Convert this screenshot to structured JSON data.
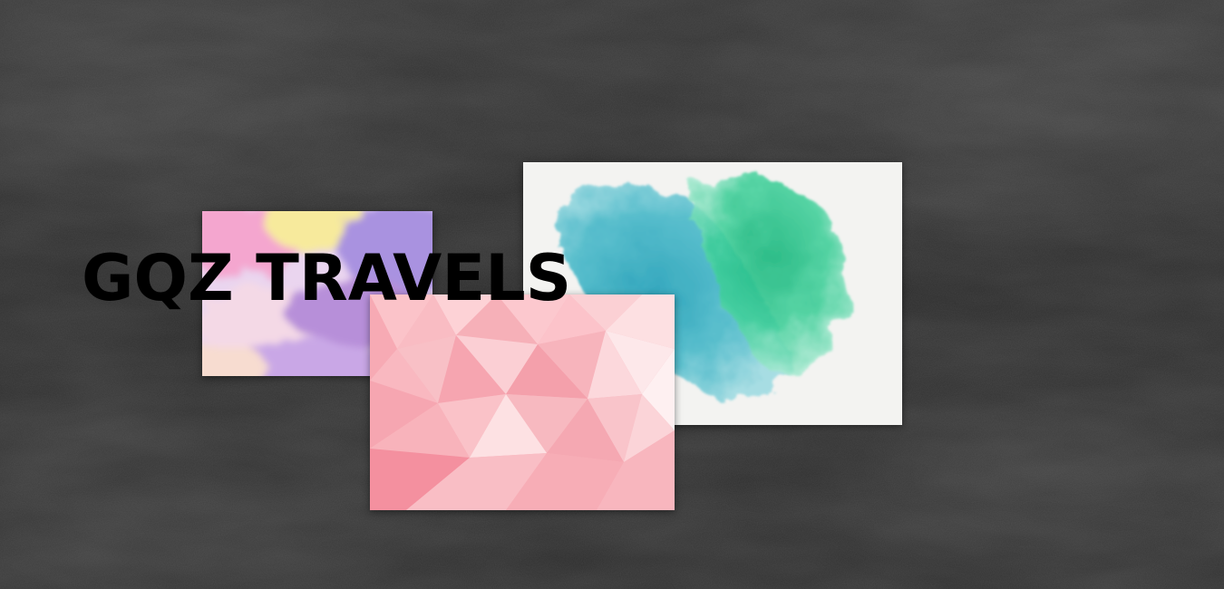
{
  "brand": {
    "title": "GQZ TRAVELS",
    "title_color": "#000000"
  },
  "background": {
    "style": "chalkboard",
    "base_color": "#2b2b2b"
  },
  "images": [
    {
      "name": "watercolor-teal-green",
      "palette": [
        "#f2f2f0",
        "#3fb8c9",
        "#2ec48f"
      ]
    },
    {
      "name": "watercolor-pastel",
      "palette": [
        "#f6c6dc",
        "#f6e79a",
        "#b79be0"
      ]
    },
    {
      "name": "low-poly-pink",
      "palette": [
        "#f8b5bd",
        "#fcd1d6",
        "#f39aa8"
      ]
    }
  ]
}
